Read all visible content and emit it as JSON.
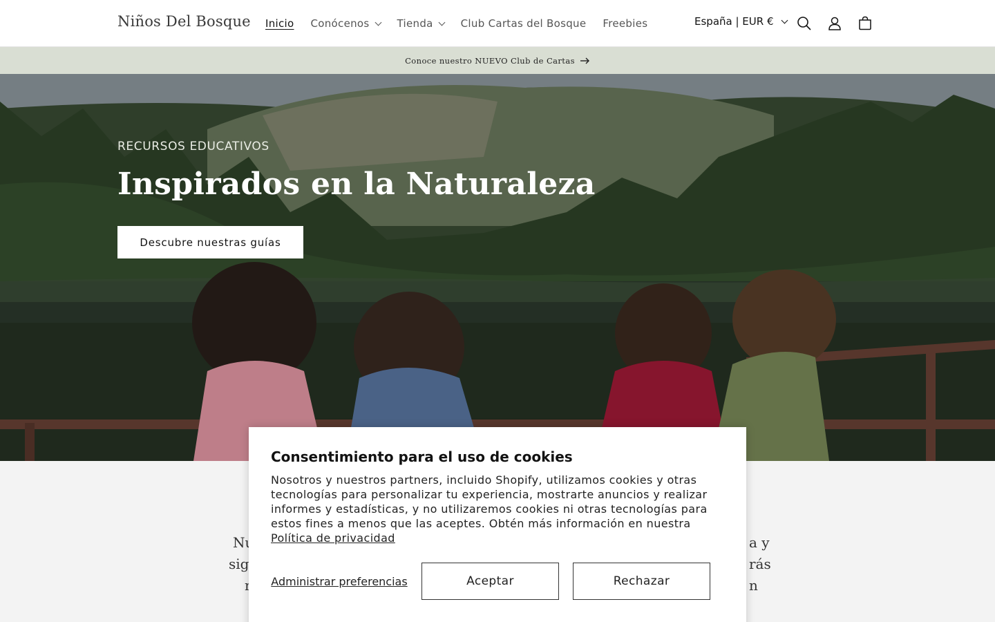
{
  "header": {
    "logo": "Niños Del Bosque",
    "nav": [
      {
        "label": "Inicio",
        "active": true,
        "has_dropdown": false
      },
      {
        "label": "Conócenos",
        "active": false,
        "has_dropdown": true
      },
      {
        "label": "Tienda",
        "active": false,
        "has_dropdown": true
      },
      {
        "label": "Club Cartas del Bosque",
        "active": false,
        "has_dropdown": false
      },
      {
        "label": "Freebies",
        "active": false,
        "has_dropdown": false
      }
    ],
    "country_selector": "España | EUR €",
    "icons": [
      "search-icon",
      "account-icon",
      "cart-icon"
    ]
  },
  "announcement": {
    "text": "Conoce nuestro NUEVO Club de Cartas",
    "icon": "arrow-right-icon",
    "background": "#d9ded3"
  },
  "hero": {
    "eyebrow": "RECURSOS EDUCATIVOS",
    "title": "Inspirados en la Naturaleza",
    "button": "Descubre nuestras guías"
  },
  "below": {
    "visible_fragments": [
      "Nu",
      "sig",
      "n",
      "a y",
      "rás",
      "n"
    ]
  },
  "cookie_banner": {
    "title": "Consentimiento para el uso de cookies",
    "body": "Nosotros y nuestros partners, incluido Shopify, utilizamos cookies y otras tecnologías para personalizar tu experiencia, mostrarte anuncios y realizar informes y estadísticas, y no utilizaremos cookies ni otras tecnologías para estos fines a menos que las aceptes. Obtén más información en nuestra",
    "privacy_link": "Política de privacidad",
    "manage_button": "Administrar preferencias",
    "accept_button": "Aceptar",
    "reject_button": "Rechazar"
  }
}
